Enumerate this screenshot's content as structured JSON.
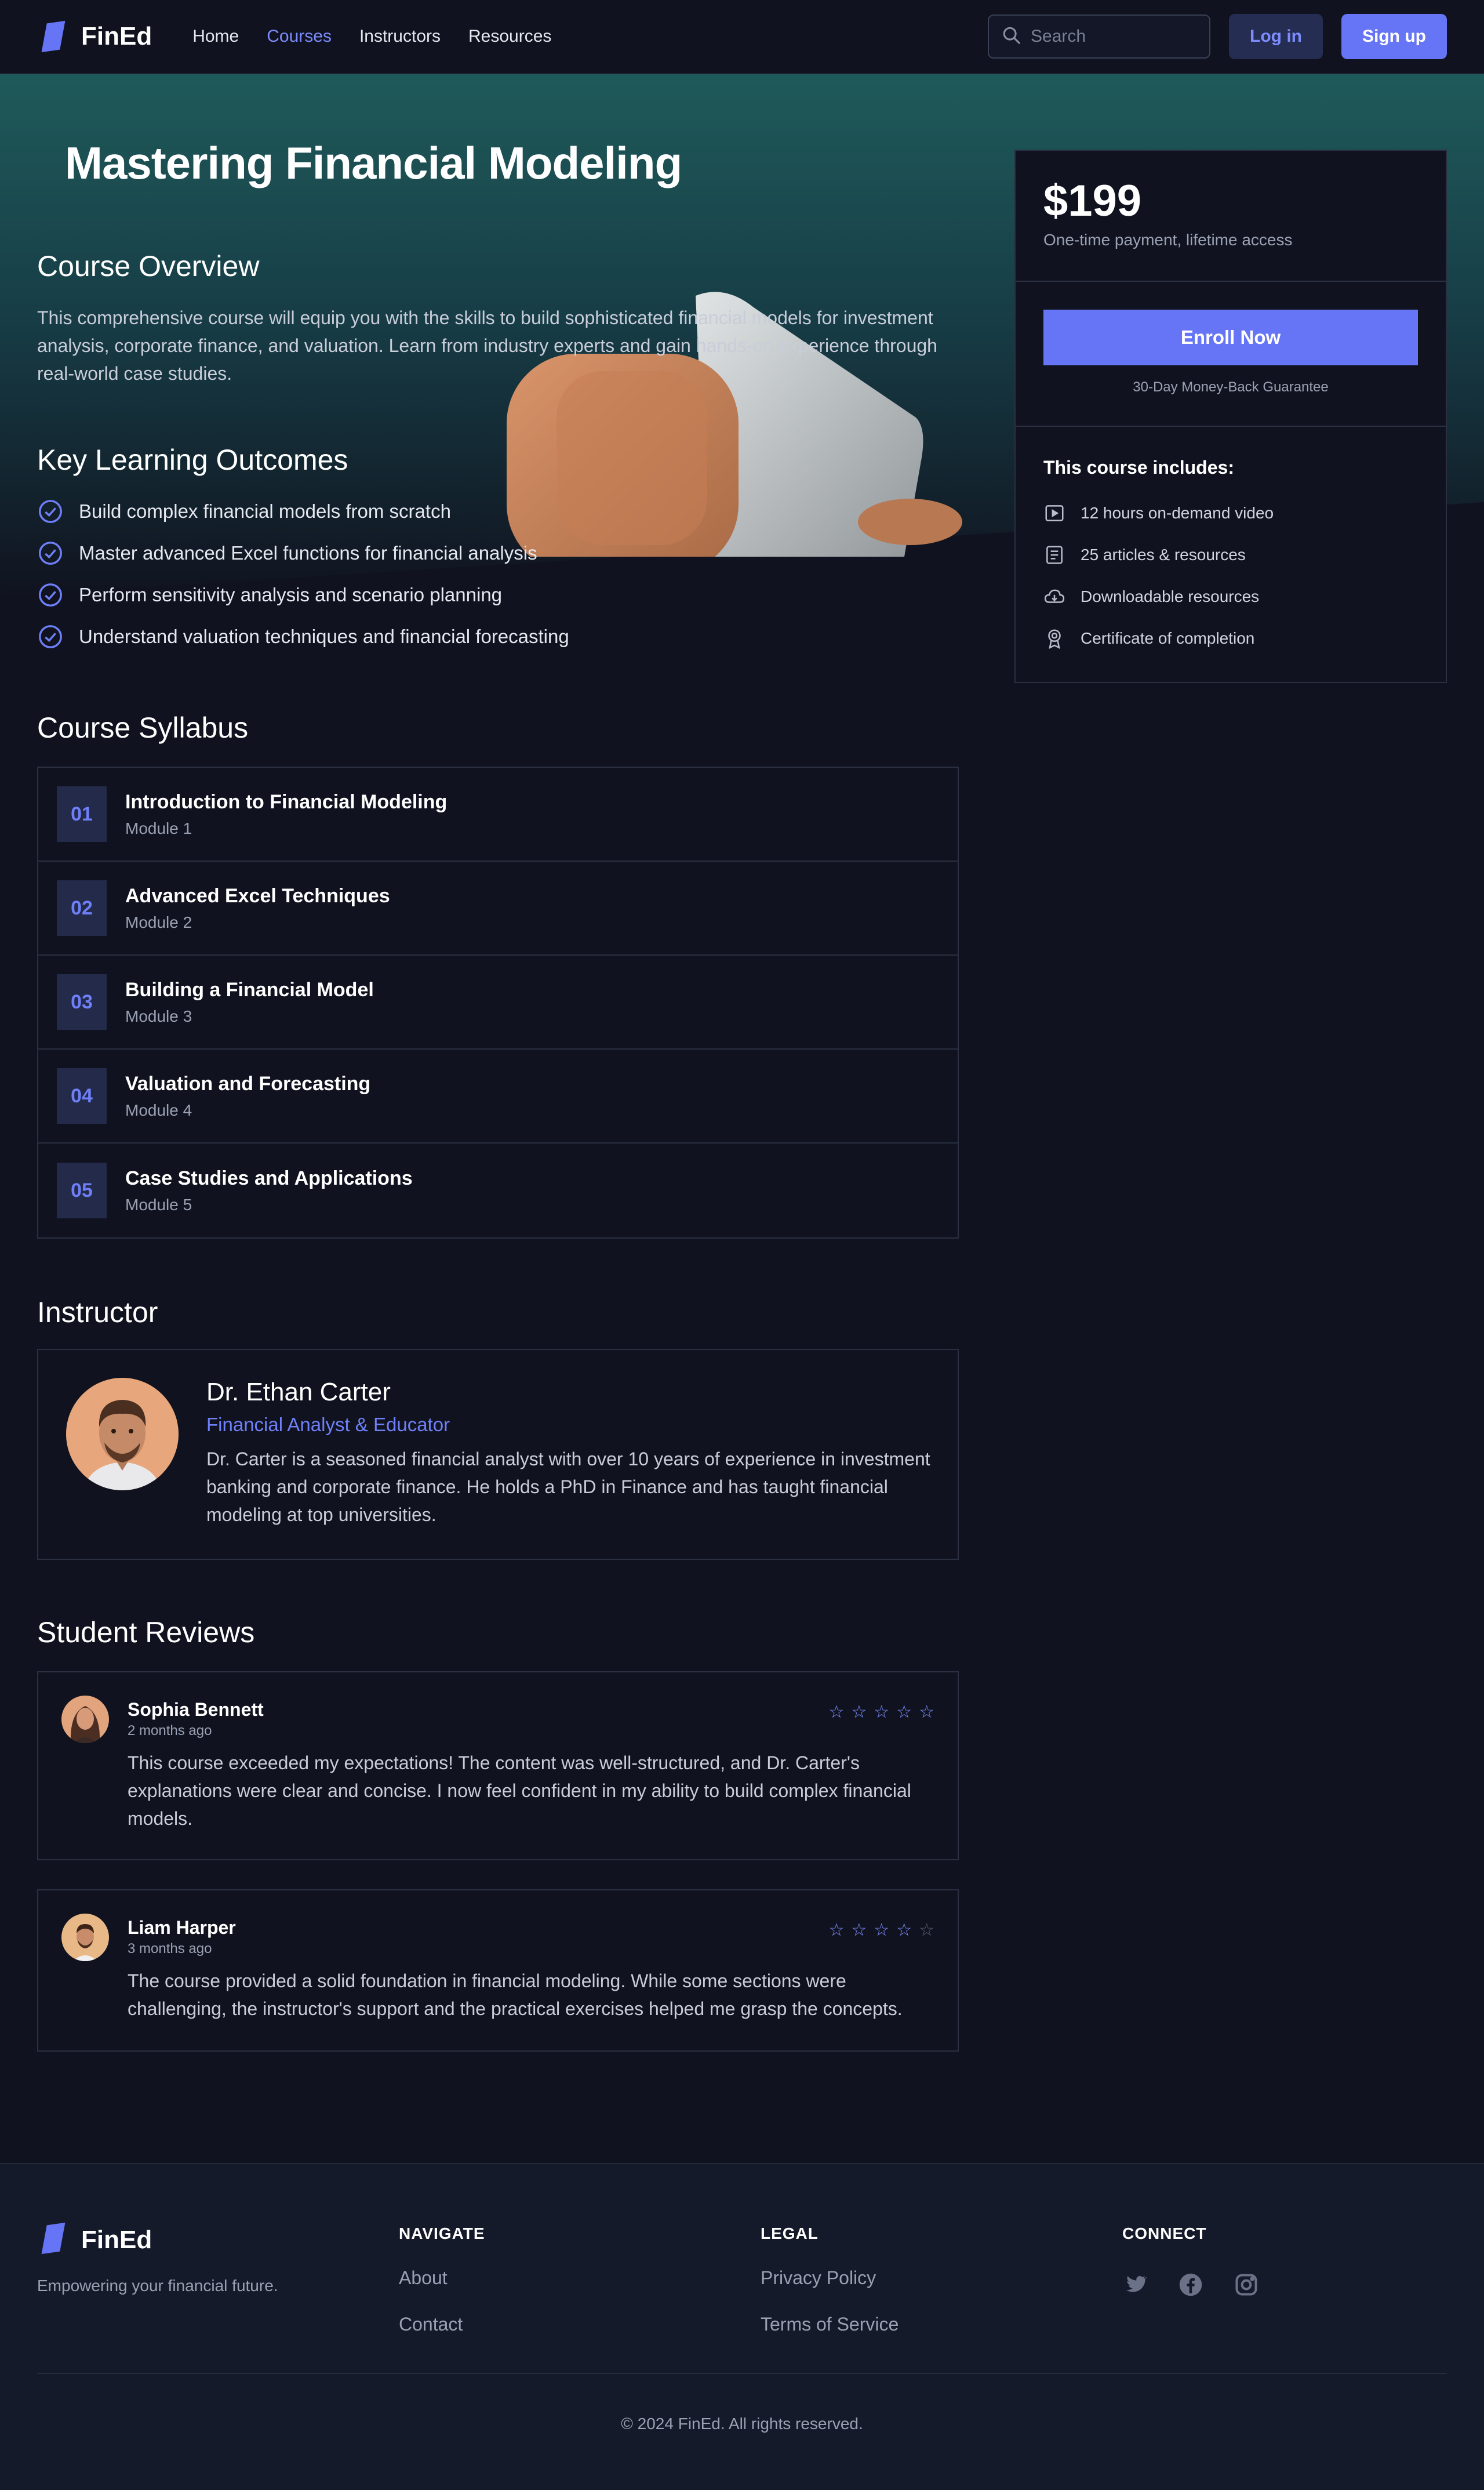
{
  "nav": {
    "brand": "FinEd",
    "links": [
      {
        "label": "Home",
        "active": false
      },
      {
        "label": "Courses",
        "active": true
      },
      {
        "label": "Instructors",
        "active": false
      },
      {
        "label": "Resources",
        "active": false
      }
    ],
    "search_placeholder": "Search",
    "login_label": "Log in",
    "signup_label": "Sign up"
  },
  "hero": {
    "title": "Mastering Financial Modeling"
  },
  "overview": {
    "heading": "Course Overview",
    "text": "This comprehensive course will equip you with the skills to build sophisticated financial models for investment analysis, corporate finance, and valuation. Learn from industry experts and gain hands-on experience through real-world case studies."
  },
  "outcomes": {
    "heading": "Key Learning Outcomes",
    "items": [
      "Build complex financial models from scratch",
      "Master advanced Excel functions for financial analysis",
      "Perform sensitivity analysis and scenario planning",
      "Understand valuation techniques and financial forecasting"
    ]
  },
  "syllabus": {
    "heading": "Course Syllabus",
    "modules": [
      {
        "num": "01",
        "title": "Introduction to Financial Modeling",
        "sub": "Module 1"
      },
      {
        "num": "02",
        "title": "Advanced Excel Techniques",
        "sub": "Module 2"
      },
      {
        "num": "03",
        "title": "Building a Financial Model",
        "sub": "Module 3"
      },
      {
        "num": "04",
        "title": "Valuation and Forecasting",
        "sub": "Module 4"
      },
      {
        "num": "05",
        "title": "Case Studies and Applications",
        "sub": "Module 5"
      }
    ]
  },
  "instructor": {
    "heading": "Instructor",
    "name": "Dr. Ethan Carter",
    "role": "Financial Analyst & Educator",
    "bio": "Dr. Carter is a seasoned financial analyst with over 10 years of experience in investment banking and corporate finance. He holds a PhD in Finance and has taught financial modeling at top universities."
  },
  "reviews": {
    "heading": "Student Reviews",
    "items": [
      {
        "name": "Sophia Bennett",
        "time": "2 months ago",
        "rating": 5,
        "text": "This course exceeded my expectations! The content was well-structured, and Dr. Carter's explanations were clear and concise. I now feel confident in my ability to build complex financial models."
      },
      {
        "name": "Liam Harper",
        "time": "3 months ago",
        "rating": 4,
        "text": "The course provided a solid foundation in financial modeling. While some sections were challenging, the instructor's support and the practical exercises helped me grasp the concepts."
      }
    ]
  },
  "pricing": {
    "price": "$199",
    "note": "One-time payment, lifetime access",
    "enroll_label": "Enroll Now",
    "guarantee": "30-Day Money-Back Guarantee",
    "includes_heading": "This course includes:",
    "includes": [
      {
        "icon": "video-icon",
        "label": "12 hours on-demand video"
      },
      {
        "icon": "article-icon",
        "label": "25 articles & resources"
      },
      {
        "icon": "cloud-download-icon",
        "label": "Downloadable resources"
      },
      {
        "icon": "certificate-icon",
        "label": "Certificate of completion"
      }
    ]
  },
  "footer": {
    "brand": "FinEd",
    "tagline": "Empowering your financial future.",
    "navigate_heading": "NAVIGATE",
    "navigate_links": [
      "About",
      "Contact"
    ],
    "legal_heading": "LEGAL",
    "legal_links": [
      "Privacy Policy",
      "Terms of Service"
    ],
    "connect_heading": "CONNECT",
    "social": [
      "twitter-icon",
      "facebook-icon",
      "instagram-icon"
    ],
    "copyright": "© 2024 FinEd. All rights reserved."
  },
  "colors": {
    "background": "#10131f",
    "accent": "#6675f5",
    "accent_text": "#7c8cff",
    "star_inactive": "#5a6075"
  }
}
